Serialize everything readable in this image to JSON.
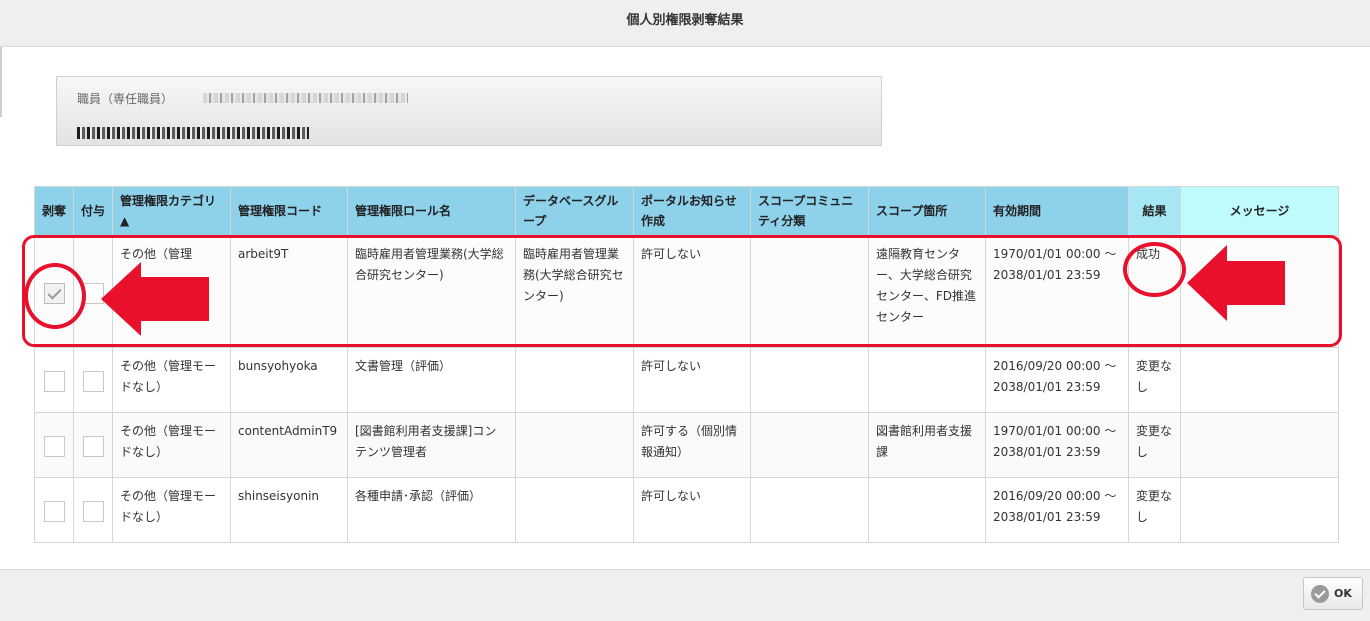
{
  "dialog": {
    "title": "個人別権限剥奪結果"
  },
  "info": {
    "label": "職員（専任職員）"
  },
  "table": {
    "headers": {
      "revoke": "剥奪",
      "grant": "付与",
      "category": "管理権限カテゴリ▲",
      "code": "管理権限コード",
      "role": "管理権限ロール名",
      "db_group": "データベースグループ",
      "portal": "ポータルお知らせ作成",
      "scope_class": "スコープコミュニティ分類",
      "scope_place": "スコープ箇所",
      "period": "有効期間",
      "result": "結果",
      "message": "メッセージ"
    },
    "rows": [
      {
        "revoke_checked": true,
        "category": "その他（管理",
        "code": "arbeit9T",
        "role": "臨時雇用者管理業務(大学総合研究センター)",
        "db_group": "臨時雇用者管理業務(大学総合研究センター)",
        "portal": "許可しない",
        "scope_class": "",
        "scope_place": "遠隔教育センター、大学総合研究センター、FD推進センター",
        "period": "1970/01/01 00:00 ～2038/01/01 23:59",
        "result": "成功",
        "message": ""
      },
      {
        "revoke_checked": false,
        "category": "その他（管理モードなし）",
        "code": "bunsyohyoka",
        "role": "文書管理（評価）",
        "db_group": "",
        "portal": "許可しない",
        "scope_class": "",
        "scope_place": "",
        "period": "2016/09/20 00:00 ～2038/01/01 23:59",
        "result": "変更なし",
        "message": ""
      },
      {
        "revoke_checked": false,
        "category": "その他（管理モードなし）",
        "code": "contentAdminT9",
        "role": "[図書館利用者支援課]コンテンツ管理者",
        "db_group": "",
        "portal": "許可する（個別情報通知）",
        "scope_class": "",
        "scope_place": "図書館利用者支援課",
        "period": "1970/01/01 00:00 ～2038/01/01 23:59",
        "result": "変更なし",
        "message": ""
      },
      {
        "revoke_checked": false,
        "category": "その他（管理モードなし）",
        "code": "shinseisyonin",
        "role": "各種申請･承認（評価）",
        "db_group": "",
        "portal": "許可しない",
        "scope_class": "",
        "scope_place": "",
        "period": "2016/09/20 00:00 ～2038/01/01 23:59",
        "result": "変更なし",
        "message": ""
      }
    ]
  },
  "footer": {
    "ok_label": "OK"
  },
  "colors": {
    "header": "#8ed1ea",
    "annotation": "#e8102a"
  },
  "icons": {
    "ok": "check-circle-icon",
    "arrow_left": "arrow-left-icon",
    "arrow_right": "arrow-left-icon"
  }
}
